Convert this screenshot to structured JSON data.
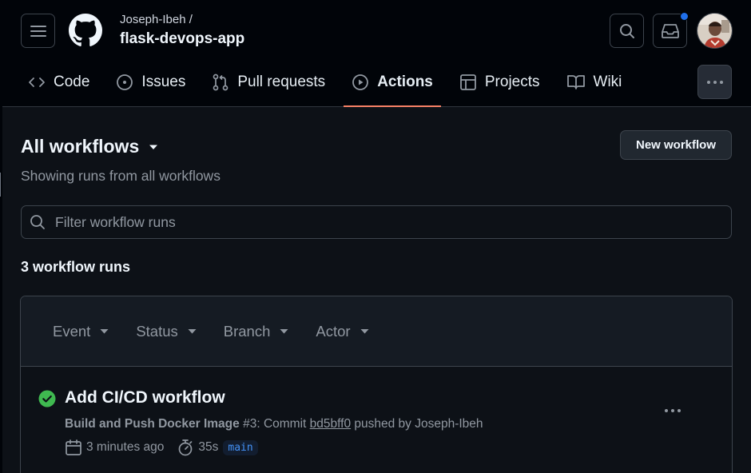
{
  "header": {
    "owner": "Joseph-Ibeh /",
    "repo": "flask-devops-app"
  },
  "tabs": [
    {
      "label": "Code",
      "icon": "code-icon"
    },
    {
      "label": "Issues",
      "icon": "issue-opened-icon"
    },
    {
      "label": "Pull requests",
      "icon": "git-pull-request-icon"
    },
    {
      "label": "Actions",
      "icon": "play-icon",
      "active": true
    },
    {
      "label": "Projects",
      "icon": "table-icon"
    },
    {
      "label": "Wiki",
      "icon": "book-icon"
    }
  ],
  "main": {
    "title": "All workflows",
    "subtitle": "Showing runs from all workflows",
    "new_workflow_label": "New workflow",
    "filter_placeholder": "Filter workflow runs",
    "run_count": "3 workflow runs",
    "filters": [
      "Event",
      "Status",
      "Branch",
      "Actor"
    ]
  },
  "runs": [
    {
      "title": "Add CI/CD workflow",
      "workflow": "Build and Push Docker Image",
      "number": "#3",
      "commit_prefix": ": Commit ",
      "sha": "bd5bff0",
      "pushed_by": " pushed by Joseph-Ibeh",
      "when": "3 minutes ago",
      "duration": "35s",
      "branch": "main",
      "status": "success"
    }
  ],
  "colors": {
    "accent": "#f78166",
    "success": "#3fb950",
    "link": "#4493f8",
    "notification": "#1f6feb"
  }
}
